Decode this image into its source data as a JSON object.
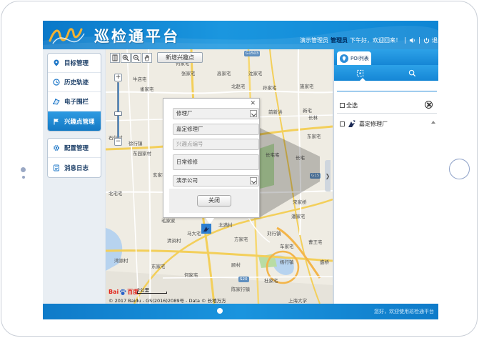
{
  "app": {
    "title": "巡检通平台",
    "colors": {
      "header": "#1a96df",
      "accent": "#1586d5",
      "nav_active": "#2e9be2"
    }
  },
  "header": {
    "user_role": "演示管理员",
    "user_name": "管理员",
    "greeting": "下午好，欢迎回来！",
    "logout_label": "退出",
    "icons": [
      "speaker-icon",
      "power-icon"
    ]
  },
  "nav": {
    "group1": [
      {
        "label": "目标管理",
        "icon": "location-pin-icon",
        "active": false
      },
      {
        "label": "历史轨迹",
        "icon": "history-icon",
        "active": false
      },
      {
        "label": "电子围栏",
        "icon": "fence-icon",
        "active": false
      },
      {
        "label": "兴趣点管理",
        "icon": "flag-icon",
        "active": true
      }
    ],
    "group2": [
      {
        "label": "配置管理",
        "icon": "gear-icon",
        "active": false
      },
      {
        "label": "消息日志",
        "icon": "log-icon",
        "active": false
      }
    ]
  },
  "map": {
    "new_poi_button": "新增兴趣点",
    "tools": [
      "pan-icon",
      "zoom-in-icon",
      "zoom-out-icon",
      "hand-icon"
    ],
    "zoom_level_fraction": 0.42,
    "scale_label": "2公里",
    "baidu_logo_text": "Bai",
    "baidu_logo_text2": "百度",
    "copyright": "© 2017 Baidu - GS(2016)2089号 - Data © 长地万方",
    "labels": [
      "何家宅",
      "张家宅",
      "高家宅",
      "沈家宅",
      "牛店宅",
      "雀家宅",
      "施家宅",
      "北赵宅",
      "孙家宅",
      "前新洪",
      "新宅",
      "长林",
      "石化村",
      "徐行镇",
      "东家宅",
      "东园家村",
      "长宅宅",
      "玄家宅",
      "马",
      "北宅宅",
      "宋家桥",
      "毛家家",
      "潘家宅",
      "马大宅",
      "方家宅",
      "清涧村",
      "北满村",
      "刘行镇",
      "车家宅",
      "曹王宅",
      "杨行镇",
      "杜家宅",
      "顾村",
      "盛桥",
      "东家宅",
      "何家宅",
      "陈家行镇",
      "上海大学",
      "湾源村",
      "长宅"
    ],
    "road_tags": [
      "G15",
      "S20",
      "G1503"
    ]
  },
  "popup": {
    "category": "修理厂",
    "name": "嘉定修理厂",
    "code_placeholder": "兴趣点编号",
    "description": "日常修修",
    "company": "演示公司",
    "close_button": "关闭"
  },
  "poi_panel": {
    "tab_label": "POI列表",
    "select_all": "全选",
    "items": [
      {
        "label": "嘉定修理厂",
        "checked": false
      }
    ]
  },
  "footer": {
    "message": "您好，欢迎使用巡检通平台"
  }
}
